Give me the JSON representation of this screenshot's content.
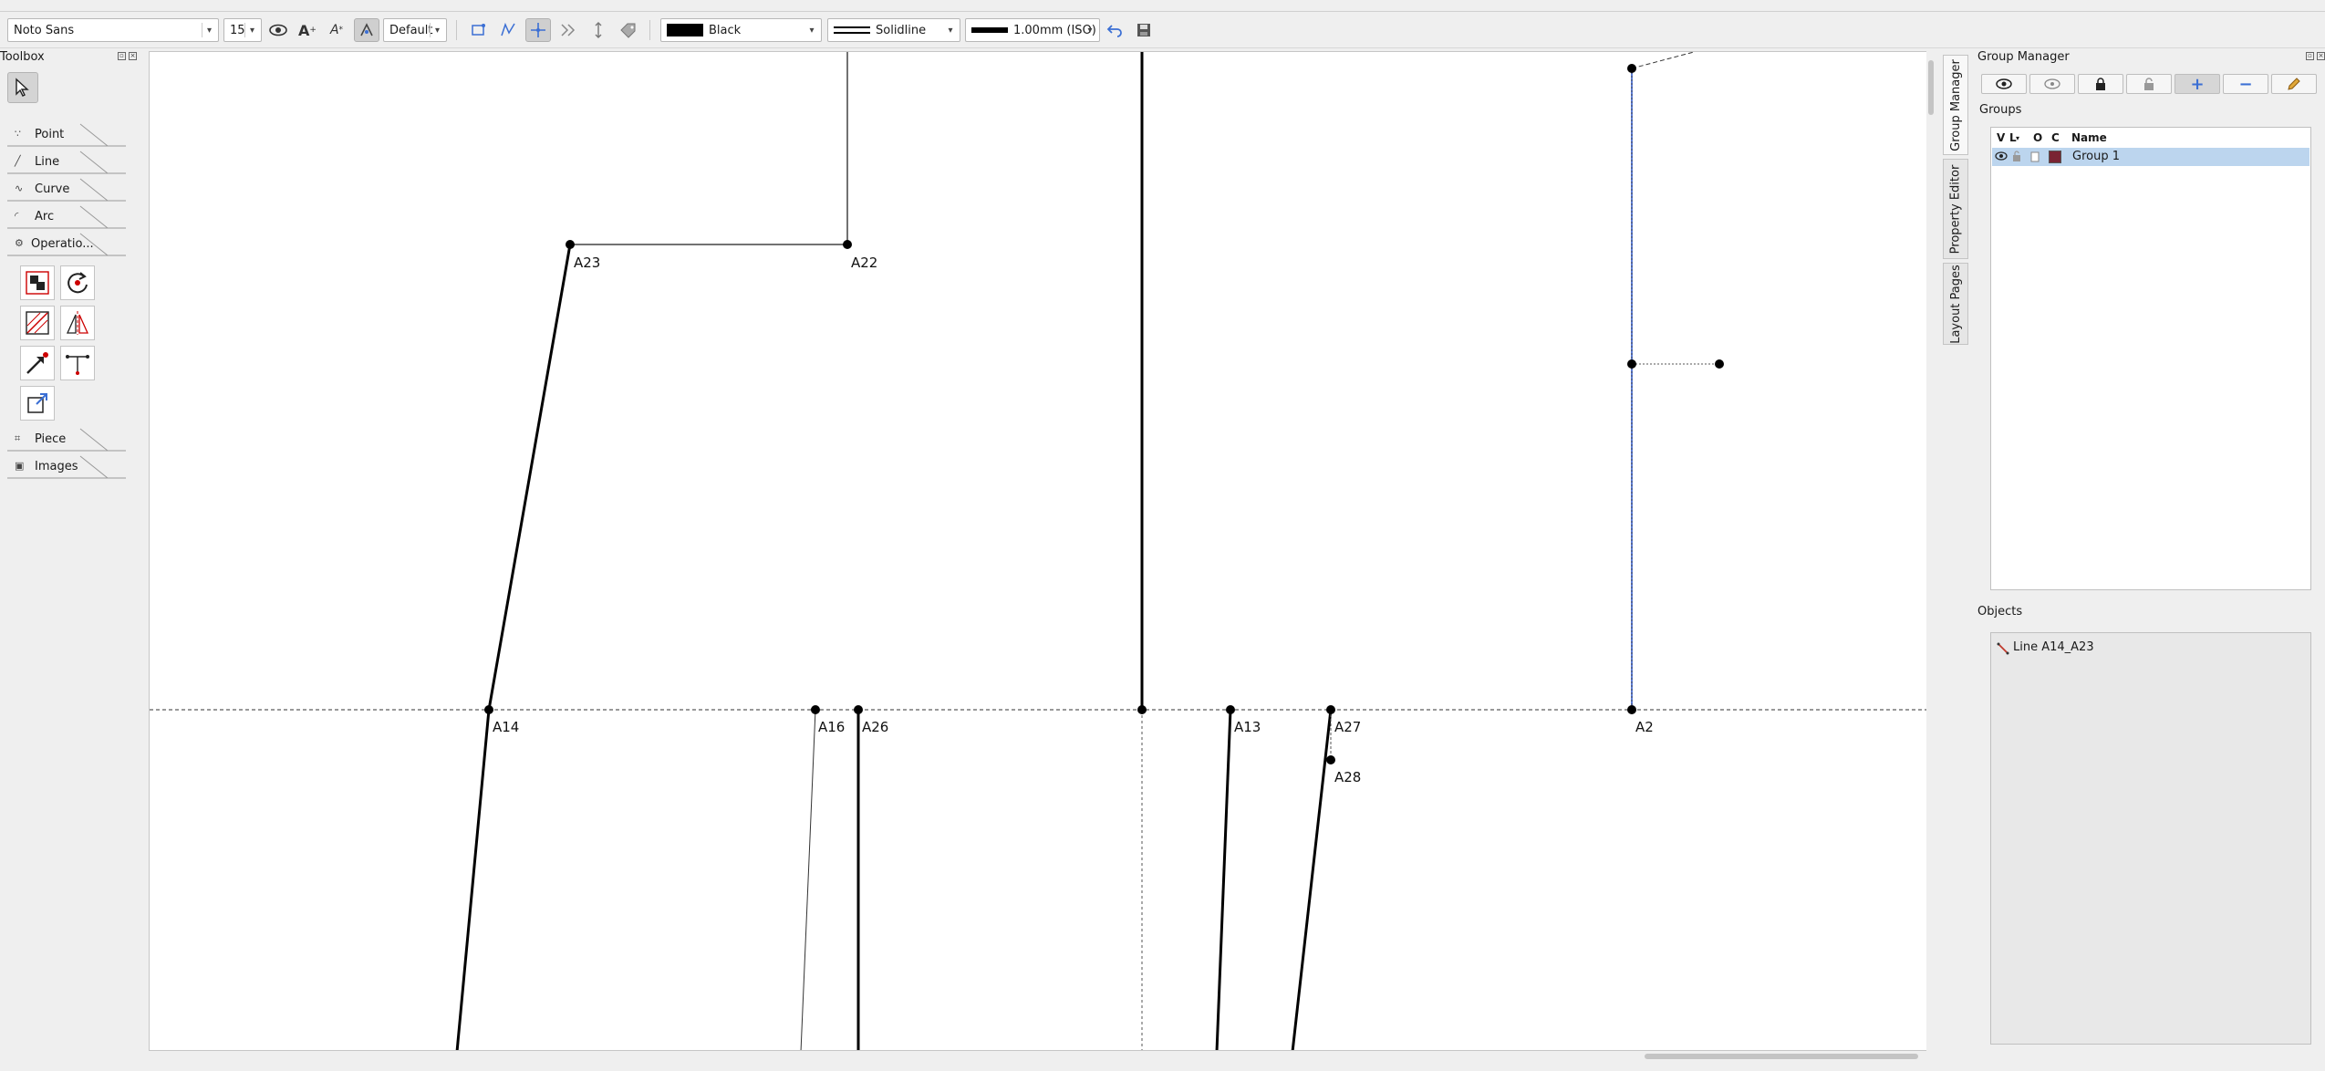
{
  "toolbar": {
    "font_name": "Noto Sans",
    "font_size": "15",
    "label_style": "Default",
    "line_color": "Black",
    "line_style": "Solidline",
    "line_weight": "1.00mm (ISO)"
  },
  "toolbox": {
    "title": "Toolbox",
    "categories": [
      "Point",
      "Line",
      "Curve",
      "Arc",
      "Operatio...",
      "Piece",
      "Images"
    ]
  },
  "points": [
    "A23",
    "A22",
    "A14",
    "A16",
    "A26",
    "A13",
    "A27",
    "A28",
    "A2"
  ],
  "right_tabs": [
    "Group Manager",
    "Property Editor",
    "Layout Pages"
  ],
  "group_manager": {
    "title": "Group Manager",
    "groups_label": "Groups",
    "columns": [
      "V",
      "L",
      "O",
      "C",
      "Name"
    ],
    "groups": [
      {
        "name": "Group 1",
        "color": "#7a2433"
      }
    ],
    "objects_label": "Objects",
    "objects": [
      "Line A14_A23"
    ]
  },
  "colors": {
    "accent": "#3b6fd4",
    "selection": "#bcd5ee"
  }
}
